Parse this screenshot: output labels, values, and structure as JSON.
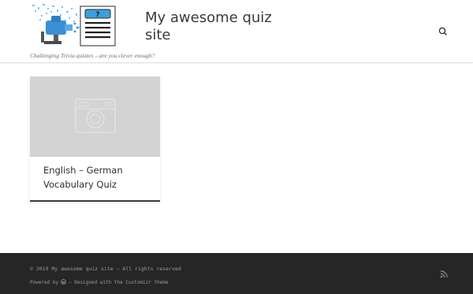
{
  "header": {
    "site_title": "My awesome quiz site",
    "tagline": "Challenging Trivia quizzes – are you clever enough?",
    "logo_question_mark": "?",
    "search_icon": "search-icon"
  },
  "main": {
    "posts": [
      {
        "title": "English – German Vocabulary Quiz",
        "thumbnail_icon": "camera-placeholder-icon"
      }
    ]
  },
  "footer": {
    "copyright": "© 2019 My awesome quiz site – All rights reserved",
    "powered_by": "Powered by",
    "designed_with": "– Designed with the Customizr theme",
    "rss_icon": "rss-icon"
  },
  "colors": {
    "footer_bg": "#262626",
    "thumb_bg": "#d3d3d3",
    "logo_blue": "#3a8fd6",
    "title_text": "#3b3b3b"
  }
}
